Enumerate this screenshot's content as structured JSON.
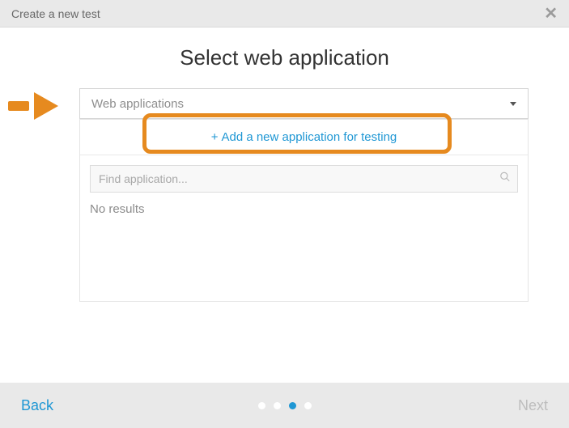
{
  "header": {
    "title": "Create a new test"
  },
  "main": {
    "title": "Select web application",
    "select": {
      "label": "Web applications"
    },
    "add_link": "Add a new application for testing",
    "search": {
      "placeholder": "Find application...",
      "value": ""
    },
    "no_results": "No results"
  },
  "footer": {
    "back": "Back",
    "next": "Next",
    "steps": {
      "total": 4,
      "active": 3
    }
  }
}
